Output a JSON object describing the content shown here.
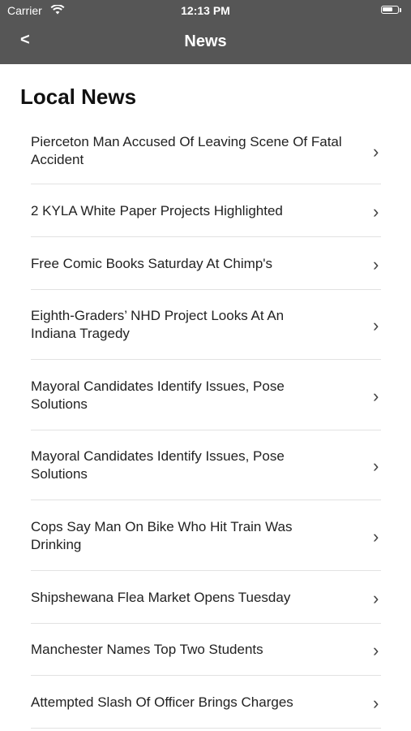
{
  "status_bar": {
    "carrier": "Carrier",
    "time": "12:13 PM"
  },
  "nav": {
    "back_label": "<",
    "title": "News"
  },
  "section": {
    "title": "Local News"
  },
  "items": [
    {
      "title": "Pierceton Man Accused Of Leaving Scene Of Fatal Accident"
    },
    {
      "title": "2 KYLA White Paper Projects Highlighted"
    },
    {
      "title": "Free Comic Books Saturday At Chimp's"
    },
    {
      "title": "Eighth-Graders’ NHD Project Looks At An Indiana Tragedy"
    },
    {
      "title": "Mayoral Candidates Identify Issues, Pose Solutions"
    },
    {
      "title": "Mayoral Candidates Identify Issues, Pose Solutions"
    },
    {
      "title": "Cops Say Man On Bike Who Hit Train Was Drinking"
    },
    {
      "title": "Shipshewana Flea Market Opens Tuesday"
    },
    {
      "title": "Manchester Names Top Two Students"
    },
    {
      "title": "Attempted Slash Of Officer Brings Charges"
    }
  ]
}
